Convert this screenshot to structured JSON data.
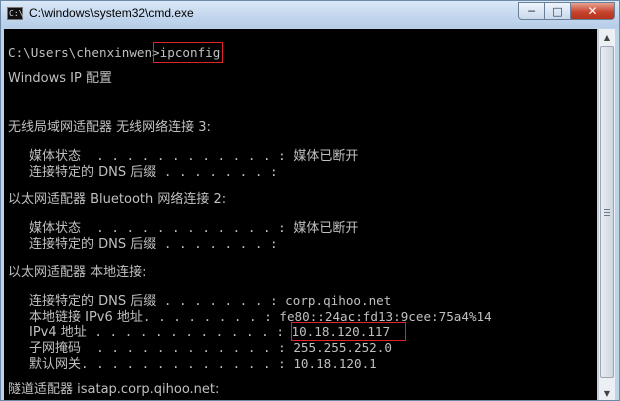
{
  "window": {
    "title": "C:\\windows\\system32\\cmd.exe",
    "icon_text": "C:\\",
    "controls": {
      "minimize": "─",
      "maximize": "□",
      "close": "✕"
    }
  },
  "console": {
    "prompt": "C:\\Users\\chenxinwen>",
    "command": "ipconfig",
    "header": "Windows IP 配置",
    "sections": [
      {
        "title": "无线局域网适配器 无线网络连接 3:",
        "rows": [
          {
            "label": "媒体状态",
            "dots": "  . . . . . . . . . . . . : ",
            "value": "媒体已断开"
          },
          {
            "label": "连接特定的 DNS 后缀",
            "dots": " . . . . . . . : ",
            "value": ""
          }
        ]
      },
      {
        "title": "以太网适配器 Bluetooth 网络连接 2:",
        "rows": [
          {
            "label": "媒体状态",
            "dots": "  . . . . . . . . . . . . : ",
            "value": "媒体已断开"
          },
          {
            "label": "连接特定的 DNS 后缀",
            "dots": " . . . . . . . : ",
            "value": ""
          }
        ]
      },
      {
        "title": "以太网适配器 本地连接:",
        "rows": [
          {
            "label": "连接特定的 DNS 后缀",
            "dots": " . . . . . . . : ",
            "value": "corp.qihoo.net"
          },
          {
            "label": "本地链接 IPv6 地址",
            "dots": ". . . . . . . . : ",
            "value": "fe80::24ac:fd13:9cee:75a4%14"
          },
          {
            "label": "IPv4 地址",
            "dots": " . . . . . . . . . . . . : ",
            "value": "10.18.120.117"
          },
          {
            "label": "子网掩码",
            "dots": "  . . . . . . . . . . . . : ",
            "value": "255.255.252.0"
          },
          {
            "label": "默认网关",
            "dots": ". . . . . . . . . . . . . : ",
            "value": "10.18.120.1"
          }
        ]
      }
    ],
    "footer": "隧道适配器 isatap.corp.qihoo.net:"
  },
  "colors": {
    "console_bg": "#000000",
    "console_text": "#c0c0c0",
    "highlight": "#e0232b"
  },
  "scrollbar": {
    "up": "▲",
    "down": "▼"
  }
}
